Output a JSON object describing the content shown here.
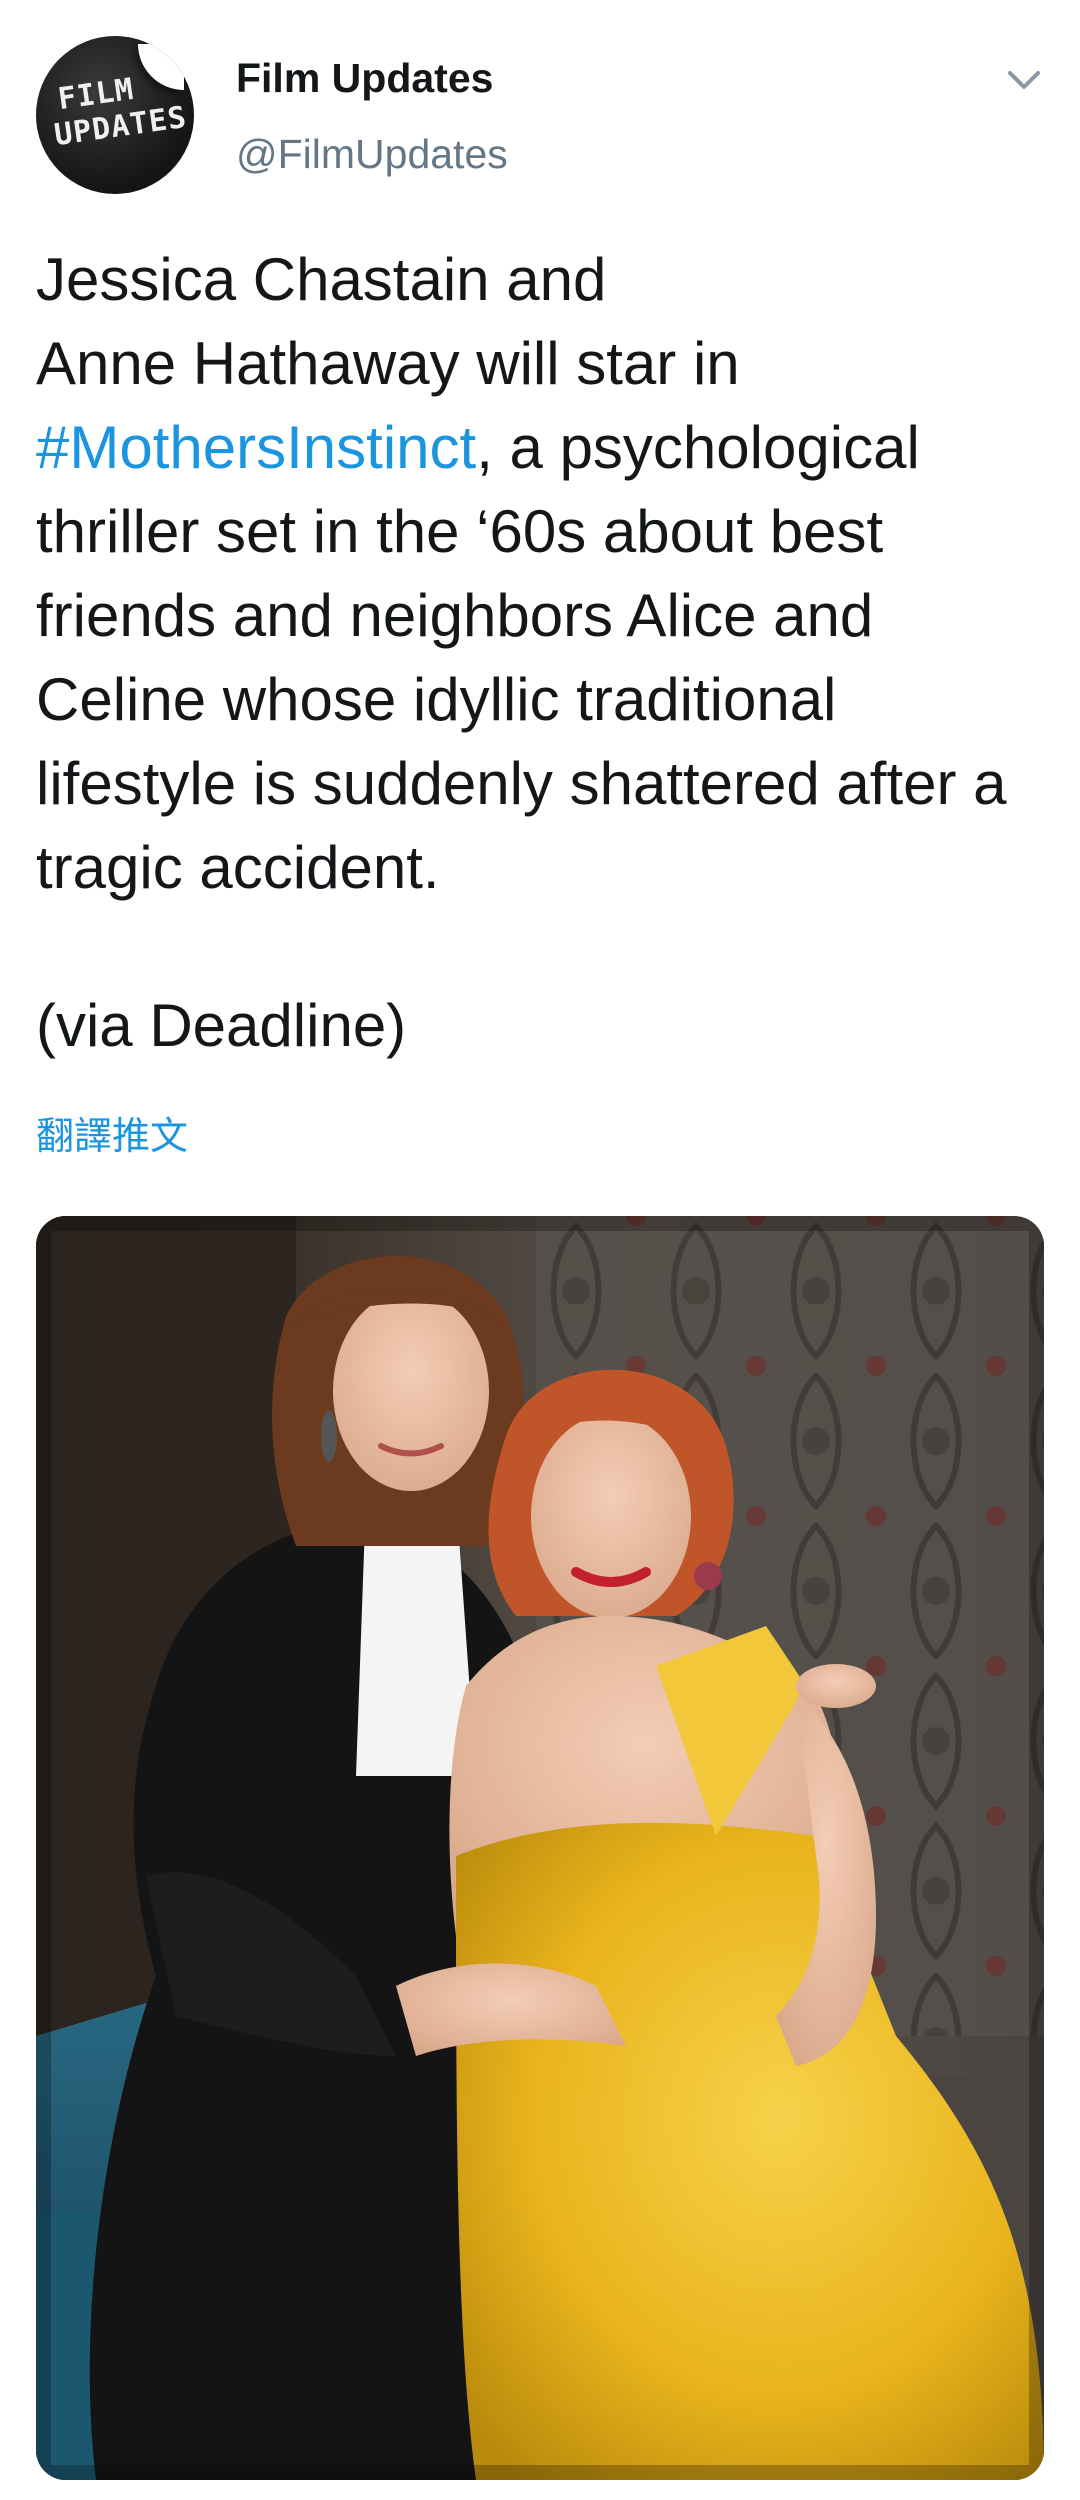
{
  "account": {
    "display_name": "Film Updates",
    "handle": "@FilmUpdates",
    "avatar_logo_line1": "FILM",
    "avatar_logo_line2": "UPDATES"
  },
  "tweet": {
    "text_before_hashtag": "Jessica Chastain and\nAnne Hathaway will star in\n",
    "hashtag": "#MothersInstinct",
    "text_after_hashtag": ", a psychological thriller set in the ‘60s about best friends and neighbors Alice and Celine whose idyllic traditional lifestyle is suddenly shattered after a tragic accident.",
    "source_note": "(via Deadline)",
    "translate_label": "翻譯推文"
  },
  "icons": {
    "menu": "chevron-down-icon"
  },
  "colors": {
    "link": "#1b95e0",
    "secondary_text": "#657786",
    "primary_text": "#14171a"
  }
}
